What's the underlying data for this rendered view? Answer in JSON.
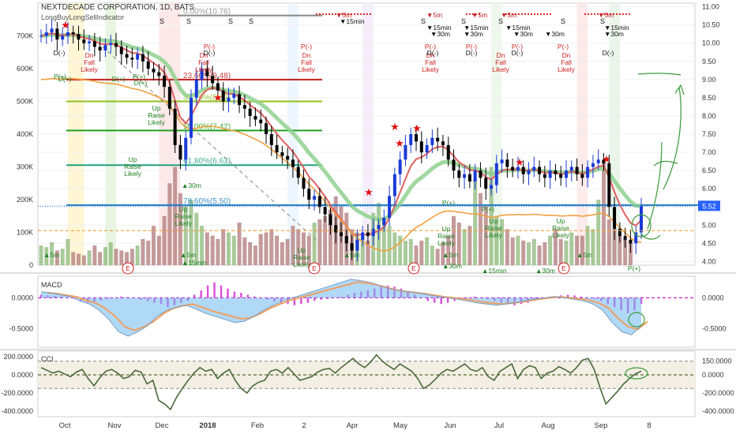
{
  "header": {
    "symbol_line": "NEXTDECADE CORPORATION, 1D, BATS",
    "indicator_line": "LongBuyLongSellIndicator"
  },
  "colors": {
    "bull": "#1a3bd6",
    "bear": "#000000",
    "ema_fast": "#e06060",
    "ema_slow": "#8fd18f",
    "orange": "#f0a040",
    "volume_up": "#8cb87a",
    "volume_down": "#b07a7a",
    "macd_hist": "#d020d0",
    "cci_line": "#4a6a3a",
    "last_price": "#2962ff"
  },
  "chart_data": [
    {
      "type": "candlestick",
      "title": "NEXTDECADE CORPORATION, 1D, BATS",
      "y_right_ticks": [
        "11.00",
        "10.50",
        "10.00",
        "9.50",
        "9.00",
        "8.50",
        "8.00",
        "7.50",
        "7.00",
        "6.50",
        "6.00",
        "5.50",
        "5.00",
        "4.50",
        "4.00"
      ],
      "y_right_range": [
        3.9,
        11.1
      ],
      "y_left_ticks": [
        "0",
        "100K",
        "200K",
        "300K",
        "400K",
        "500K",
        "600K",
        "700K"
      ],
      "y_left_range": [
        0,
        800000
      ],
      "x_ticks": [
        "Oct",
        "Nov",
        "Dec",
        "2018",
        "Feb",
        "2",
        "Apr",
        "May",
        "Jun",
        "Jul",
        "Aug",
        "Sep",
        "8"
      ],
      "last_price_label": "5.52",
      "fib_levels": [
        {
          "label": "0.00%(10.76)",
          "price": 10.76,
          "color": "#888888"
        },
        {
          "label": "23.60%(9.48)",
          "price": 9.0,
          "color": "#c02020"
        },
        {
          "label": "38.20%(8.69)",
          "price": 8.4,
          "color": "#8fc020"
        },
        {
          "label": "50.00%(7.42)",
          "price": 7.6,
          "color": "#20a020"
        },
        {
          "label": "61.80%(6.63)",
          "price": 6.65,
          "color": "#20a080"
        },
        {
          "label": "78.60%(5.50)",
          "price": 5.55,
          "color": "#2080c0"
        }
      ],
      "close_series": [
        10.2,
        10.3,
        10.4,
        10.1,
        10.2,
        10.3,
        10.25,
        10.1,
        10.0,
        10.05,
        9.9,
        9.8,
        9.95,
        10.0,
        9.9,
        9.7,
        9.6,
        9.55,
        9.7,
        9.5,
        9.3,
        9.2,
        9.1,
        8.8,
        8.2,
        7.2,
        6.8,
        7.4,
        8.5,
        9.0,
        9.3,
        9.1,
        8.9,
        8.7,
        8.4,
        8.5,
        8.6,
        8.3,
        8.2,
        8.0,
        7.9,
        7.8,
        7.5,
        7.2,
        7.0,
        6.9,
        6.8,
        6.6,
        6.3,
        6.0,
        5.7,
        5.8,
        5.5,
        5.3,
        5.0,
        4.8,
        4.7,
        4.5,
        4.3,
        4.6,
        4.8,
        4.7,
        4.9,
        5.0,
        5.2,
        5.8,
        6.4,
        6.8,
        7.2,
        7.5,
        7.3,
        7.0,
        7.2,
        7.4,
        7.3,
        7.2,
        6.8,
        6.5,
        6.3,
        6.4,
        6.2,
        6.5,
        6.3,
        6.0,
        6.1,
        6.7,
        6.8,
        6.6,
        6.5,
        6.6,
        6.4,
        6.5,
        6.6,
        6.4,
        6.3,
        6.5,
        6.4,
        6.3,
        6.5,
        6.6,
        6.4,
        6.3,
        6.6,
        6.7,
        6.8,
        6.7,
        5.5,
        4.9,
        4.7,
        4.6,
        4.5,
        4.8,
        5.52
      ],
      "volume_series": [
        60,
        55,
        70,
        45,
        50,
        80,
        40,
        35,
        30,
        45,
        60,
        40,
        55,
        70,
        50,
        45,
        40,
        50,
        60,
        80,
        75,
        120,
        90,
        150,
        250,
        300,
        220,
        180,
        200,
        160,
        120,
        100,
        90,
        80,
        110,
        100,
        90,
        130,
        85,
        70,
        60,
        95,
        100,
        110,
        90,
        70,
        80,
        120,
        110,
        100,
        90,
        130,
        140,
        150,
        170,
        210,
        180,
        160,
        110,
        100,
        85,
        75,
        160,
        190,
        140,
        120,
        100,
        90,
        75,
        80,
        60,
        75,
        85,
        60,
        50,
        70,
        90,
        150,
        130,
        110,
        120,
        260,
        220,
        180,
        300,
        150,
        140,
        110,
        85,
        90,
        75,
        70,
        80,
        60,
        70,
        90,
        110,
        80,
        75,
        100,
        90,
        90,
        120,
        110,
        200,
        320,
        140,
        110,
        90,
        80,
        70
      ]
    },
    {
      "type": "line",
      "title": "MACD",
      "y_ticks": [
        "0.0000",
        "-0.5000"
      ],
      "y_range": [
        -0.8,
        0.35
      ],
      "hist": [
        0.05,
        0.04,
        0.03,
        0.02,
        0.0,
        -0.02,
        -0.05,
        -0.08,
        -0.06,
        -0.04,
        -0.02,
        0.0,
        0.02,
        0.01,
        -0.01,
        -0.03,
        -0.05,
        -0.08,
        -0.1,
        -0.15,
        -0.12,
        -0.08,
        -0.05,
        0.05,
        0.12,
        0.2,
        0.25,
        0.2,
        0.15,
        0.1,
        0.08,
        0.05,
        0.02,
        0.0,
        -0.03,
        -0.06,
        -0.08,
        -0.1,
        -0.12,
        -0.1,
        -0.08,
        -0.05,
        -0.03,
        -0.02,
        0.0,
        0.02,
        0.05,
        0.08,
        0.1,
        0.12,
        0.15,
        0.18,
        0.2,
        0.18,
        0.15,
        0.1,
        0.05,
        0.0,
        -0.05,
        -0.08,
        -0.1,
        -0.08,
        -0.05,
        -0.02,
        0.0,
        0.02,
        0.0,
        -0.02,
        -0.05,
        -0.08,
        -0.1,
        -0.12,
        -0.1,
        -0.08,
        -0.05,
        -0.02,
        0.0,
        0.02,
        0.04,
        0.05,
        0.04,
        0.02,
        0.0,
        -0.02,
        -0.05,
        -0.1,
        -0.15,
        -0.2,
        -0.25,
        -0.2,
        -0.1
      ],
      "macd": [
        0.1,
        0.08,
        0.05,
        0.02,
        -0.05,
        -0.1,
        -0.2,
        -0.35,
        -0.55,
        -0.62,
        -0.55,
        -0.45,
        -0.3,
        -0.2,
        -0.15,
        -0.12,
        -0.18,
        -0.25,
        -0.3,
        -0.35,
        -0.4,
        -0.38,
        -0.3,
        -0.2,
        -0.12,
        -0.05,
        0.0,
        0.05,
        0.1,
        0.15,
        0.2,
        0.25,
        0.3,
        0.28,
        0.25,
        0.2,
        0.15,
        0.12,
        0.1,
        0.08,
        0.05,
        0.02,
        0.0,
        -0.02,
        -0.05,
        -0.08,
        -0.1,
        -0.12,
        -0.1,
        -0.08,
        -0.05,
        -0.02,
        0.0,
        0.02,
        0.0,
        -0.02,
        -0.05,
        -0.1,
        -0.2,
        -0.4,
        -0.55,
        -0.6,
        -0.45
      ]
    },
    {
      "type": "line",
      "title": "CCI",
      "y_ticks": [
        "200.0000",
        "0.0000",
        "-200.0000",
        "-400.0000"
      ],
      "y_range": [
        -460,
        260
      ],
      "bands": [
        150,
        0,
        -150
      ],
      "values": [
        80,
        50,
        20,
        40,
        10,
        -20,
        30,
        60,
        -40,
        -120,
        -30,
        40,
        60,
        20,
        -40,
        -20,
        50,
        30,
        -100,
        -60,
        -280,
        -320,
        -380,
        -250,
        -150,
        -60,
        20,
        80,
        40,
        60,
        -40,
        20,
        60,
        -60,
        -150,
        -200,
        -120,
        -80,
        -60,
        40,
        60,
        20,
        80,
        10,
        -60,
        -40,
        -20,
        30,
        60,
        70,
        20,
        80,
        130,
        180,
        120,
        80,
        140,
        220,
        150,
        100,
        60,
        120,
        80,
        40,
        -40,
        -150,
        -110,
        -50,
        20,
        60,
        40,
        80,
        120,
        60,
        40,
        80,
        -20,
        -60,
        40,
        80,
        120,
        -40,
        60,
        100,
        80,
        -40,
        20,
        40,
        90,
        60,
        20,
        80,
        160,
        180,
        60,
        -140,
        -320,
        -250,
        -180,
        -100,
        -40,
        10,
        40
      ]
    }
  ],
  "price_labels": {
    "fib_0": "0.00%(10.76)",
    "fib_23": "23.60%(9.48)",
    "fib_38": "38.20%(8.69)",
    "fib_50": "50.00%(7.42)",
    "fib_61": "61.80%(6.63)",
    "fib_78": "78.60%(5.50)"
  },
  "annotations": {
    "dn_fall_likely": "Dn Fall Likely",
    "up_raise_likely": "Up Raise Likely",
    "d_minus": "D(-)",
    "d_plus": "D(+)",
    "p_minus": "P(-)",
    "p_plus": "P(+)",
    "fifteen_min": "▼15min",
    "thirty_min": "▼30m",
    "five_m": "▼5m",
    "s": "S",
    "e": "E",
    "up_15min": "▲15min",
    "up_30m": "▲30m",
    "up_5m": "▲5m"
  }
}
